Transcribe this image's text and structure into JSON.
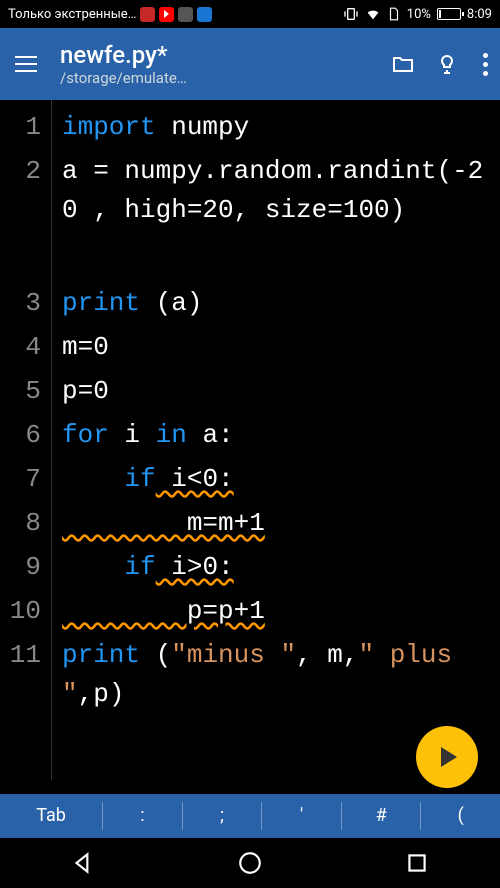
{
  "status": {
    "carrier": "Только экстренные…",
    "battery_pct": "10%",
    "time": "8:09"
  },
  "toolbar": {
    "filename": "newfe.py*",
    "path": "/storage/emulate…"
  },
  "gutter": [
    "1",
    "2",
    "3",
    "4",
    "5",
    "6",
    "7",
    "8",
    "9",
    "10",
    "11"
  ],
  "code": {
    "l1": {
      "kw": "import",
      "rest": " numpy"
    },
    "l2": "a = numpy.random.randint(-20 , high=20, size=100)",
    "l3": {
      "fn": "print",
      "rest": " (a)"
    },
    "l4": "m=0",
    "l5": "p=0",
    "l6": {
      "p1": "for",
      "p2": " i ",
      "p3": "in",
      "p4": " a:"
    },
    "l7": {
      "p1": "    ",
      "kw": "if",
      "cond": " i<0:"
    },
    "l8": "        m=m+1",
    "l9": {
      "p1": "    ",
      "kw": "if",
      "cond": " i>0:"
    },
    "l10": "        p=p+1",
    "l11": {
      "fn": "print",
      "paren": " (",
      "s1": "\"minus  \"",
      "c1": ", m,",
      "s2": "\" plus \"",
      "c2": ",p)"
    }
  },
  "keyrow": [
    "Tab",
    ":",
    ";",
    "'",
    "#",
    "("
  ],
  "icons": {
    "burger": "menu-icon",
    "folder": "folder-icon",
    "bulb": "bulb-icon",
    "more": "more-vert-icon",
    "fab": "play-icon"
  }
}
